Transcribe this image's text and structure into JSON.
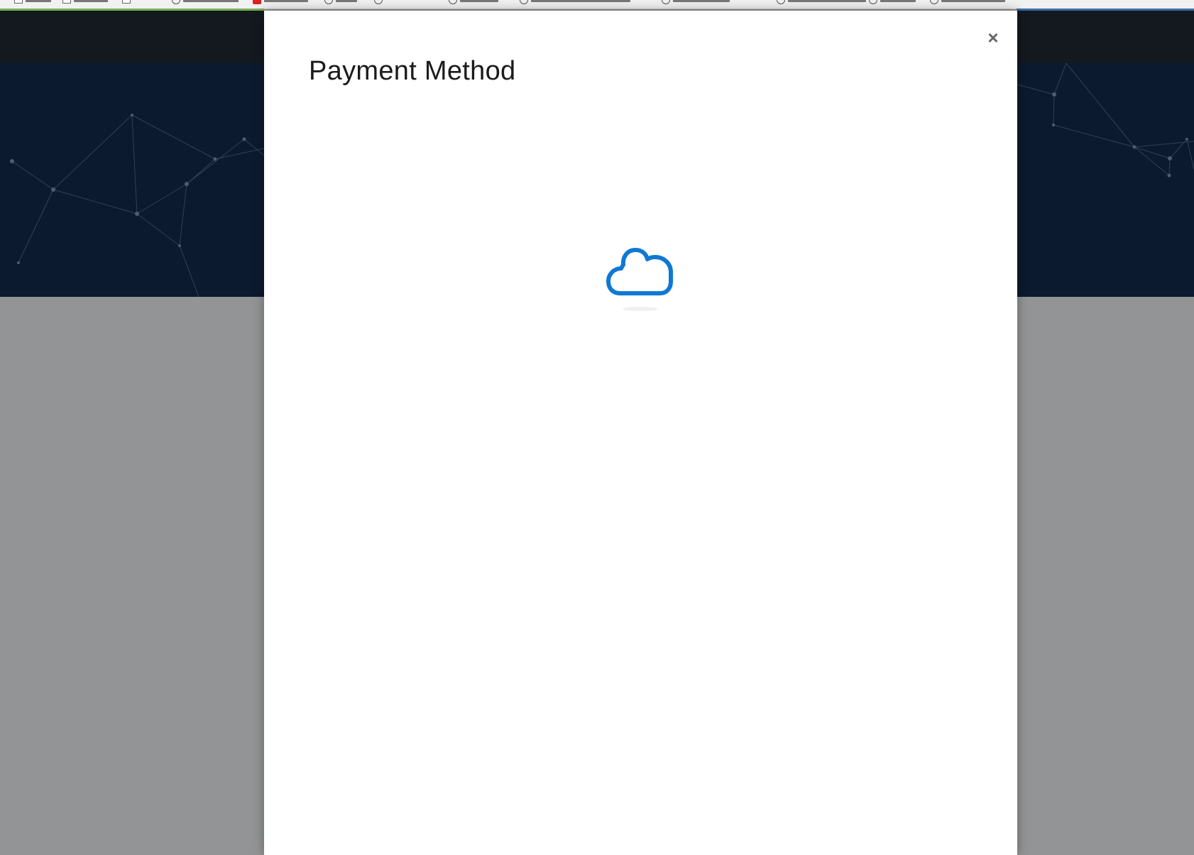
{
  "modal": {
    "title": "Payment Method",
    "close_label": "×"
  },
  "loader": {
    "icon": "cloud-icon",
    "color": "#0f78d4"
  },
  "colors": {
    "overlay": "#939495",
    "hero": "#0b1a2e",
    "topnav": "#14191f",
    "modal_bg": "#ffffff"
  }
}
